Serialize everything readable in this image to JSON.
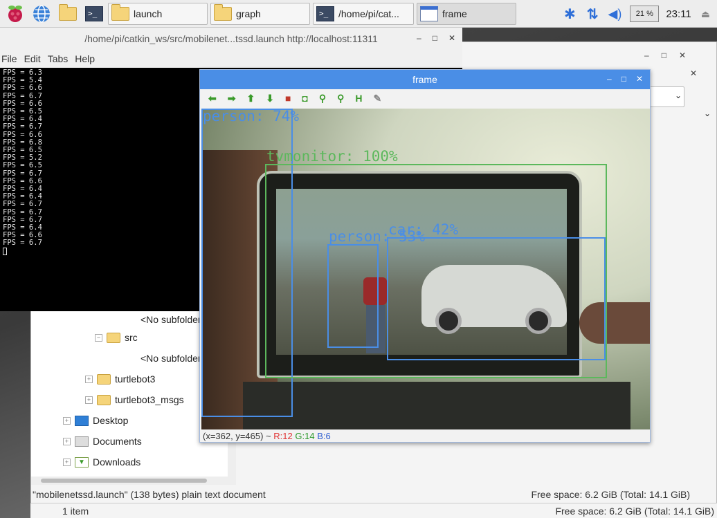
{
  "taskbar": {
    "tasks": [
      {
        "label": "launch",
        "icon": "folder-icon"
      },
      {
        "label": "graph",
        "icon": "folder-icon"
      },
      {
        "label": "/home/pi/cat...",
        "icon": "terminal-icon"
      },
      {
        "label": "frame",
        "icon": "window-icon"
      }
    ],
    "cpu": "21 %",
    "clock": "23:11"
  },
  "terminal": {
    "title": "/home/pi/catkin_ws/src/mobilenet...tssd.launch http://localhost:11311",
    "menu": [
      "File",
      "Edit",
      "Tabs",
      "Help"
    ],
    "lines": [
      "FPS = 6.3",
      "FPS = 5.4",
      "FPS = 6.6",
      "FPS = 6.7",
      "FPS = 6.6",
      "FPS = 6.5",
      "FPS = 6.4",
      "FPS = 6.7",
      "FPS = 6.6",
      "FPS = 6.8",
      "FPS = 6.5",
      "FPS = 5.2",
      "FPS = 6.5",
      "FPS = 6.7",
      "FPS = 6.6",
      "FPS = 6.4",
      "FPS = 6.4",
      "FPS = 6.7",
      "FPS = 6.7",
      "FPS = 6.7",
      "FPS = 6.4",
      "FPS = 6.6",
      "FPS = 6.7"
    ]
  },
  "filemanager": {
    "tree": {
      "no_subfolders": "<No subfolders>",
      "src": "src",
      "turtlebot3": "turtlebot3",
      "turtlebot3_msgs": "turtlebot3_msgs",
      "desktop": "Desktop",
      "documents": "Documents",
      "downloads": "Downloads"
    },
    "status_left": "\"mobilenetssd.launch\" (138 bytes) plain text document",
    "status_right": "Free space: 6.2 GiB (Total: 14.1 GiB)",
    "bottom_left": "1 item",
    "bottom_right": "Free space: 6.2 GiB (Total: 14.1 GiB)"
  },
  "frame": {
    "title": "frame",
    "detections": [
      {
        "label": "person: 74%",
        "color": "#4a8ee6"
      },
      {
        "label": "tvmonitor: 100%",
        "color": "#5cb85c"
      },
      {
        "label": "person: 53%",
        "color": "#4a8ee6"
      },
      {
        "label": "car: 42%",
        "color": "#4a8ee6"
      }
    ],
    "coords_prefix": "(x=362, y=465) ~",
    "r": "R:12",
    "g": "G:14",
    "b": "B:6"
  }
}
